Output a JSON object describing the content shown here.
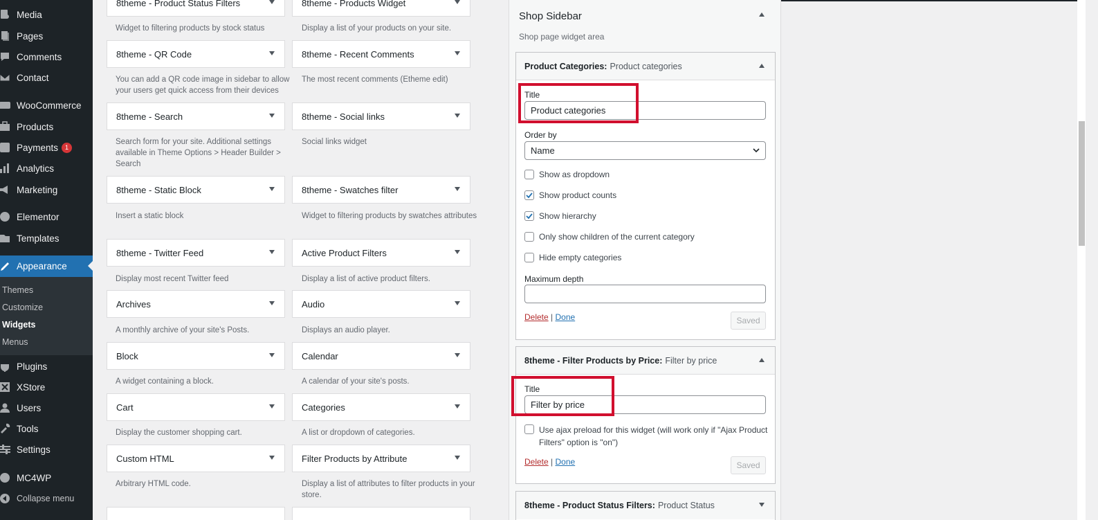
{
  "admin_menu": {
    "items": [
      {
        "label": "Media",
        "icon": "media-icon"
      },
      {
        "label": "Pages",
        "icon": "pages-icon"
      },
      {
        "label": "Comments",
        "icon": "comments-icon"
      },
      {
        "label": "Contact",
        "icon": "contact-icon"
      },
      {
        "label": "WooCommerce",
        "icon": "woocommerce-icon"
      },
      {
        "label": "Products",
        "icon": "products-icon"
      },
      {
        "label": "Payments",
        "icon": "payments-icon",
        "badge": "1"
      },
      {
        "label": "Analytics",
        "icon": "analytics-icon"
      },
      {
        "label": "Marketing",
        "icon": "marketing-icon"
      },
      {
        "label": "Elementor",
        "icon": "elementor-icon"
      },
      {
        "label": "Templates",
        "icon": "templates-icon"
      },
      {
        "label": "Appearance",
        "icon": "appearance-icon",
        "current": true
      },
      {
        "label": "Plugins",
        "icon": "plugins-icon"
      },
      {
        "label": "XStore",
        "icon": "xstore-icon"
      },
      {
        "label": "Users",
        "icon": "users-icon"
      },
      {
        "label": "Tools",
        "icon": "tools-icon"
      },
      {
        "label": "Settings",
        "icon": "settings-icon"
      },
      {
        "label": "MC4WP",
        "icon": "mc4wp-icon"
      },
      {
        "label": "Collapse menu",
        "icon": "collapse-icon"
      }
    ],
    "submenu": [
      "Themes",
      "Customize",
      "Widgets",
      "Menus"
    ],
    "submenu_active": "Widgets"
  },
  "available_widgets": [
    {
      "title": "8theme - Product Status Filters",
      "desc": "Widget to filtering products by stock status"
    },
    {
      "title": "8theme - Products Widget",
      "desc": "Display a list of your products on your site."
    },
    {
      "title": "8theme - QR Code",
      "desc": "You can add a QR code image in sidebar to allow your users get quick access from their devices"
    },
    {
      "title": "8theme - Recent Comments",
      "desc": "The most recent comments (Etheme edit)"
    },
    {
      "title": "8theme - Search",
      "desc": "Search form for your site. Additional settings available in Theme Options > Header Builder > Search"
    },
    {
      "title": "8theme - Social links",
      "desc": "Social links widget"
    },
    {
      "title": "8theme - Static Block",
      "desc": "Insert a static block"
    },
    {
      "title": "8theme - Swatches filter",
      "desc": "Widget to filtering products by swatches attributes"
    },
    {
      "title": "8theme - Twitter Feed",
      "desc": "Display most recent Twitter feed"
    },
    {
      "title": "Active Product Filters",
      "desc": "Display a list of active product filters."
    },
    {
      "title": "Archives",
      "desc": "A monthly archive of your site's Posts."
    },
    {
      "title": "Audio",
      "desc": "Displays an audio player."
    },
    {
      "title": "Block",
      "desc": "A widget containing a block."
    },
    {
      "title": "Calendar",
      "desc": "A calendar of your site's posts."
    },
    {
      "title": "Cart",
      "desc": "Display the customer shopping cart."
    },
    {
      "title": "Categories",
      "desc": "A list or dropdown of categories."
    },
    {
      "title": "Custom HTML",
      "desc": "Arbitrary HTML code."
    },
    {
      "title": "Filter Products by Attribute",
      "desc": "Display a list of attributes to filter products in your store."
    }
  ],
  "shop_sidebar": {
    "title": "Shop Sidebar",
    "description": "Shop page widget area",
    "product_categories": {
      "name": "Product Categories:",
      "subtitle": "Product categories",
      "title_label": "Title",
      "title_value": "Product categories",
      "order_label": "Order by",
      "order_value": "Name",
      "checkboxes": [
        {
          "label": "Show as dropdown",
          "checked": false
        },
        {
          "label": "Show product counts",
          "checked": true
        },
        {
          "label": "Show hierarchy",
          "checked": true
        },
        {
          "label": "Only show children of the current category",
          "checked": false
        },
        {
          "label": "Hide empty categories",
          "checked": false
        }
      ],
      "depth_label": "Maximum depth",
      "depth_value": "",
      "delete": "Delete",
      "separator": "|",
      "done": "Done",
      "saved": "Saved"
    },
    "filter_price": {
      "name": "8theme - Filter Products by Price:",
      "subtitle": "Filter by price",
      "title_label": "Title",
      "title_value": "Filter by price",
      "ajax_label_line1": "Use ajax preload for this widget (will work only if \"Ajax Product",
      "ajax_label_line2": "Filters\" option is \"on\")",
      "ajax_checked": false,
      "delete": "Delete",
      "separator": "|",
      "done": "Done",
      "saved": "Saved"
    },
    "product_status": {
      "name": "8theme - Product Status Filters:",
      "subtitle": "Product Status"
    }
  },
  "colors": {
    "admin_bg": "#1d2327",
    "accent": "#2271b1",
    "highlight_box": "#d10f2e",
    "delete_link": "#b32d2e",
    "badge": "#d63638"
  }
}
